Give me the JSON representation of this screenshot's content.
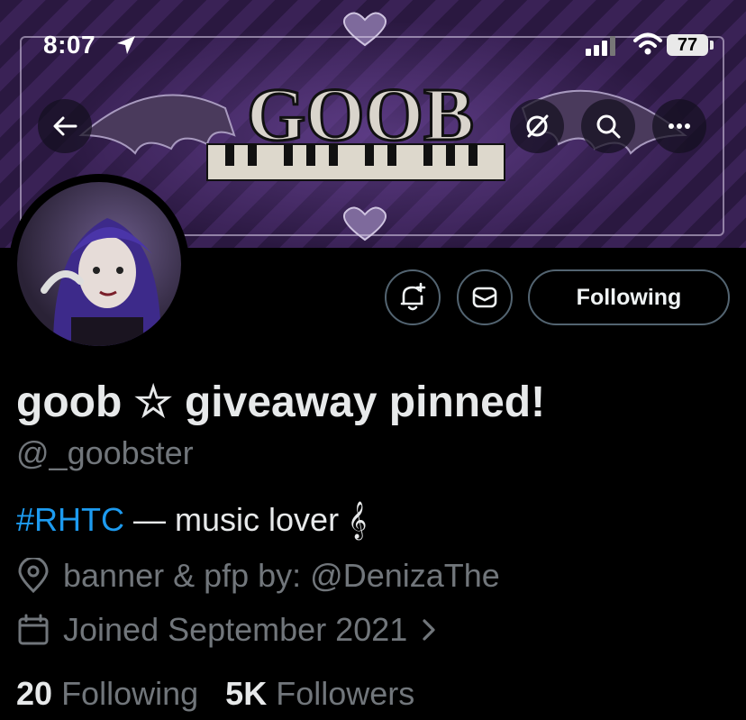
{
  "status_bar": {
    "time": "8:07",
    "battery": "77"
  },
  "banner": {
    "logo_text": "GOOB"
  },
  "icons": {
    "back": "arrow-left-icon",
    "hide": "eye-slash-icon",
    "search": "search-icon",
    "more": "more-horizontal-icon",
    "notify": "bell-plus-icon",
    "message": "envelope-icon",
    "location": "map-pin-icon",
    "calendar": "calendar-icon",
    "chevron": "chevron-right-icon"
  },
  "actions": {
    "following_label": "Following"
  },
  "profile": {
    "display_name": "goob ☆ giveaway pinned!",
    "handle": "@_goobster",
    "bio_hashtag": "#RHTC",
    "bio_text": " — music lover 𝄞",
    "location": "banner & pfp by: @DenizaThe",
    "joined": "Joined September 2021"
  },
  "stats": {
    "following_count": "20",
    "following_label": "Following",
    "followers_count": "5K",
    "followers_label": "Followers"
  },
  "colors": {
    "background": "#000000",
    "link": "#1d9bf0",
    "secondary_text": "#71767b",
    "border": "#536471",
    "banner_purple": "#3a2256"
  }
}
